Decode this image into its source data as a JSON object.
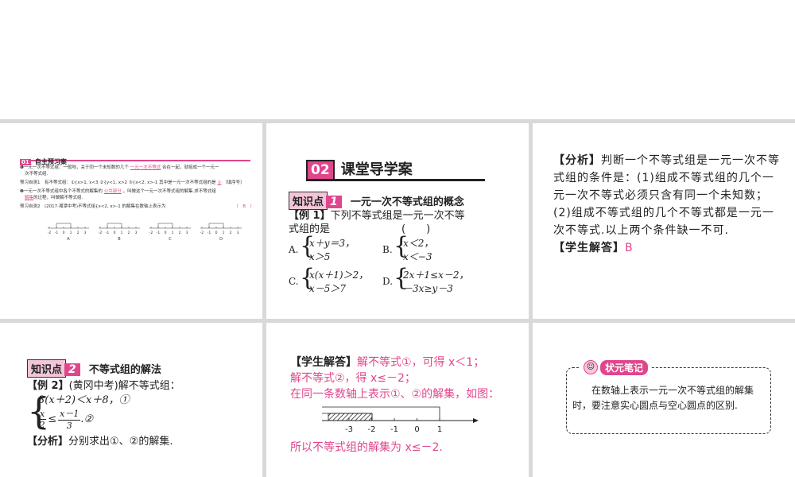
{
  "slide1": {
    "badge": "01",
    "title": "自主预习案",
    "line1": "❶一元一次不等式组：一般地，关于同一个未知数的几个",
    "line1_fill": "一元一次不等式",
    "line1_end": "合在一起，就组成一个一元一",
    "line1b": "次不等式组.",
    "line2": "预习自测1　有不等式组：①{x>1, x<3 ②{y<1, x>2 ③{x<2, x>-1 其中是一元一次不等式组的是",
    "line2_fill": "①",
    "line2_end": "（填序号）",
    "line3": "❷一元一次不等式组中各个不等式的解集的",
    "line3_fill": "公共部分",
    "line3_end": "，叫做这个一元一次不等式组的解集.求不等式组",
    "line3b_fill": "解集",
    "line3b": "的过程，叫做解不等式组.",
    "line4": "预习自测2　(2017·湘潭中考)不等式组{x<2, x>-1 的解集在数轴上表示为",
    "line4_ans": "（　B　）",
    "option_letters": [
      "A",
      "B",
      "C",
      "D"
    ],
    "axis_ticks": [
      "-2",
      "-1",
      "0",
      "1",
      "2",
      "3"
    ]
  },
  "slide2": {
    "badge": "02",
    "title": "课堂导学案",
    "kp_label": "知识点",
    "kp_num": "1",
    "kp_title": "一元一次不等式组的概念",
    "example_tag": "【例 1】",
    "example_text": "下列不等式组是一元一次不等",
    "example_text2": "式组的是",
    "paren": "(　　)",
    "optA_label": "A.",
    "optA_1": "x＋y＝3，",
    "optA_2": "x＞5",
    "optB_label": "B.",
    "optB_1": "x＜2，",
    "optB_2": "x＜−3",
    "optC_label": "C.",
    "optC_1": "x(x＋1)＞2，",
    "optC_2": "x－5＞7",
    "optD_label": "D.",
    "optD_1": "2x＋1≤x－2，",
    "optD_2": "－3x≥y－3"
  },
  "slide3": {
    "tag1": "【分析】",
    "analysis": "判断一个不等式组是一元一次不等式组的条件是：(1)组成不等式组的几个一元一次不等式必须只含有同一个未知数；(2)组成不等式组的几个不等式都是一元一次不等式.以上两个条件缺一不可.",
    "tag2": "【学生解答】",
    "answer": "B"
  },
  "slide4": {
    "kp_label": "知识点",
    "kp_num": "2",
    "kp_title": "不等式组的解法",
    "example_tag": "【例 2】",
    "example_text": "(黄冈中考)解不等式组：",
    "ineq1": "3(x＋2)＜x＋8，①",
    "ineq2_lhs_num": "x",
    "ineq2_lhs_den": "2",
    "ineq2_rel": "≤",
    "ineq2_rhs_num": "x－1",
    "ineq2_rhs_den": "3",
    "ineq2_tail": ".②",
    "tag": "【分析】",
    "analysis": "分别求出①、②的解集."
  },
  "slide5": {
    "tag": "【学生解答】",
    "l1": "解不等式①，可得 x＜1；",
    "l2": "解不等式②，得 x≤－2；",
    "l3": "在同一条数轴上表示①、②的解集，如图：",
    "ticks": [
      "-3",
      "-2",
      "-1",
      "0",
      "1"
    ],
    "l4": "所以不等式组的解集为 x≤－2."
  },
  "slide6": {
    "title": "状元笔记",
    "text": "在数轴上表示一元一次不等式组的解集时，要注意实心圆点与空心圆点的区别."
  },
  "colors": {
    "accent": "#e0468c",
    "badge_bg": "#f2c6d8",
    "grid": "#d9d9d9"
  }
}
